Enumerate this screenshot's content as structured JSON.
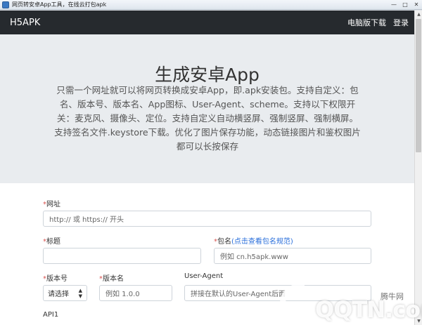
{
  "window": {
    "title": "网页转安卓App工具，在线云打包apk",
    "minimize_glyph": "—",
    "maximize_glyph": "□",
    "close_glyph": "✕"
  },
  "navbar": {
    "brand": "H5APK",
    "links": [
      "电脑版下载",
      "登录"
    ]
  },
  "hero": {
    "title": "生成安卓App",
    "description": "只需一个网址就可以将网页转换成安卓App，即.apk安装包。支持自定义：包名、版本号、版本名、App图标、User-Agent、scheme。支持以下权限开关：麦克风、摄像头、定位。支持自定义自动横竖屏、强制竖屏、强制横屏。支持签名文件.keystore下载。优化了图片保存功能，动态链接图片和鉴权图片都可以长按保存"
  },
  "form": {
    "url": {
      "required_mark": "*",
      "label": "网址",
      "placeholder": "http:// 或 https:// 开头"
    },
    "title": {
      "required_mark": "*",
      "label": "标题",
      "value": ""
    },
    "package": {
      "required_mark": "*",
      "label": "包名",
      "link": "(点击查看包名规范)",
      "placeholder": "例如 cn.h5apk.www"
    },
    "version_code": {
      "required_mark": "*",
      "label": "版本号",
      "selected": "请选择"
    },
    "version_name": {
      "required_mark": "*",
      "label": "版本名",
      "placeholder": "例如 1.0.0"
    },
    "user_agent": {
      "label": "User-Agent",
      "placeholder": "拼接在默认的User-Agent后面"
    },
    "api_label": "API1"
  },
  "watermark": {
    "brand": "QQTN.com",
    "cn": "腾牛网"
  }
}
